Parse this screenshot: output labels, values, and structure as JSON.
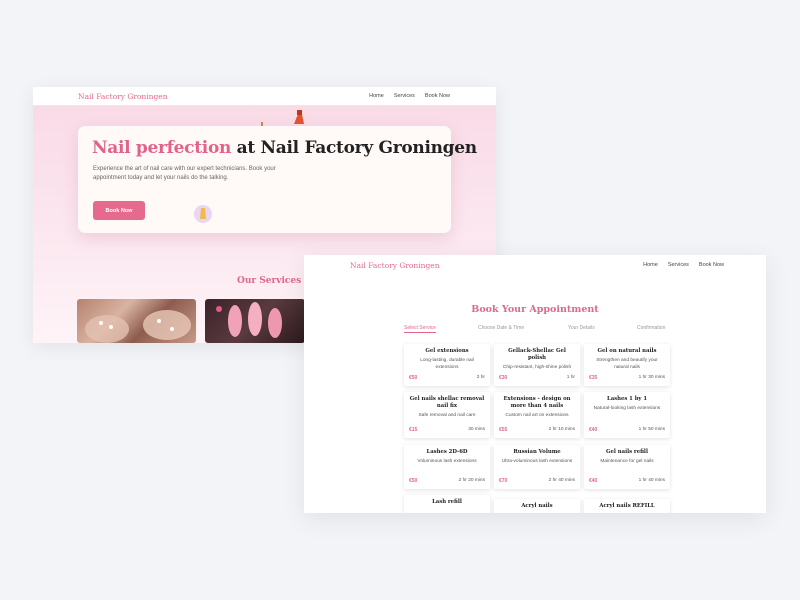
{
  "brand": "Nail Factory Groningen",
  "nav": {
    "home": "Home",
    "services": "Services",
    "book": "Book Now"
  },
  "hero": {
    "title_accent": "Nail perfection",
    "title_rest": " at Nail Factory Groningen",
    "lead": "Experience the art of nail care with our expert technicians. Book your appointment today and let your nails do the talking.",
    "cta": "Book Now"
  },
  "services_heading": "Our Services",
  "booking": {
    "title": "Book Your Appointment",
    "steps": [
      "Select Service",
      "Choose Date & Time",
      "Your Details",
      "Confirmation"
    ]
  },
  "services": [
    {
      "name": "Gel extensions",
      "desc": "Long-lasting, durable nail extensions",
      "price": "€50",
      "duration": "2 hr"
    },
    {
      "name": "Gellack-Shellac Gel polish",
      "desc": "Chip-resistant, high-shine polish",
      "price": "€30",
      "duration": "1 hr"
    },
    {
      "name": "Gel on natural nails",
      "desc": "Strengthen and beautify your natural nails",
      "price": "€35",
      "duration": "1 hr 30 mins"
    },
    {
      "name": "Gel nails shellac removal nail fix",
      "desc": "Safe removal and nail care",
      "price": "€15",
      "duration": "30 mins"
    },
    {
      "name": "Extensions - design on more than 4 nails",
      "desc": "Custom nail art on extensions",
      "price": "€55",
      "duration": "2 hr 10 mins"
    },
    {
      "name": "Lashes 1 by 1",
      "desc": "Natural-looking lash extensions",
      "price": "€40",
      "duration": "1 hr 50 mins"
    },
    {
      "name": "Lashes 2D-6D",
      "desc": "Voluminous lash extensions",
      "price": "€50",
      "duration": "2 hr 20 mins"
    },
    {
      "name": "Russian Volume",
      "desc": "Ultra-voluminous lash extensions",
      "price": "€70",
      "duration": "2 hr 40 mins"
    },
    {
      "name": "Gel nails refill",
      "desc": "Maintenance for gel nails",
      "price": "€40",
      "duration": "1 hr 40 mins"
    },
    {
      "name": "Lash refill",
      "desc": "",
      "price": "",
      "duration": ""
    },
    {
      "name": "Acryl nails",
      "desc": "",
      "price": "",
      "duration": ""
    },
    {
      "name": "Acryl nails REFILL",
      "desc": "",
      "price": "",
      "duration": ""
    }
  ]
}
